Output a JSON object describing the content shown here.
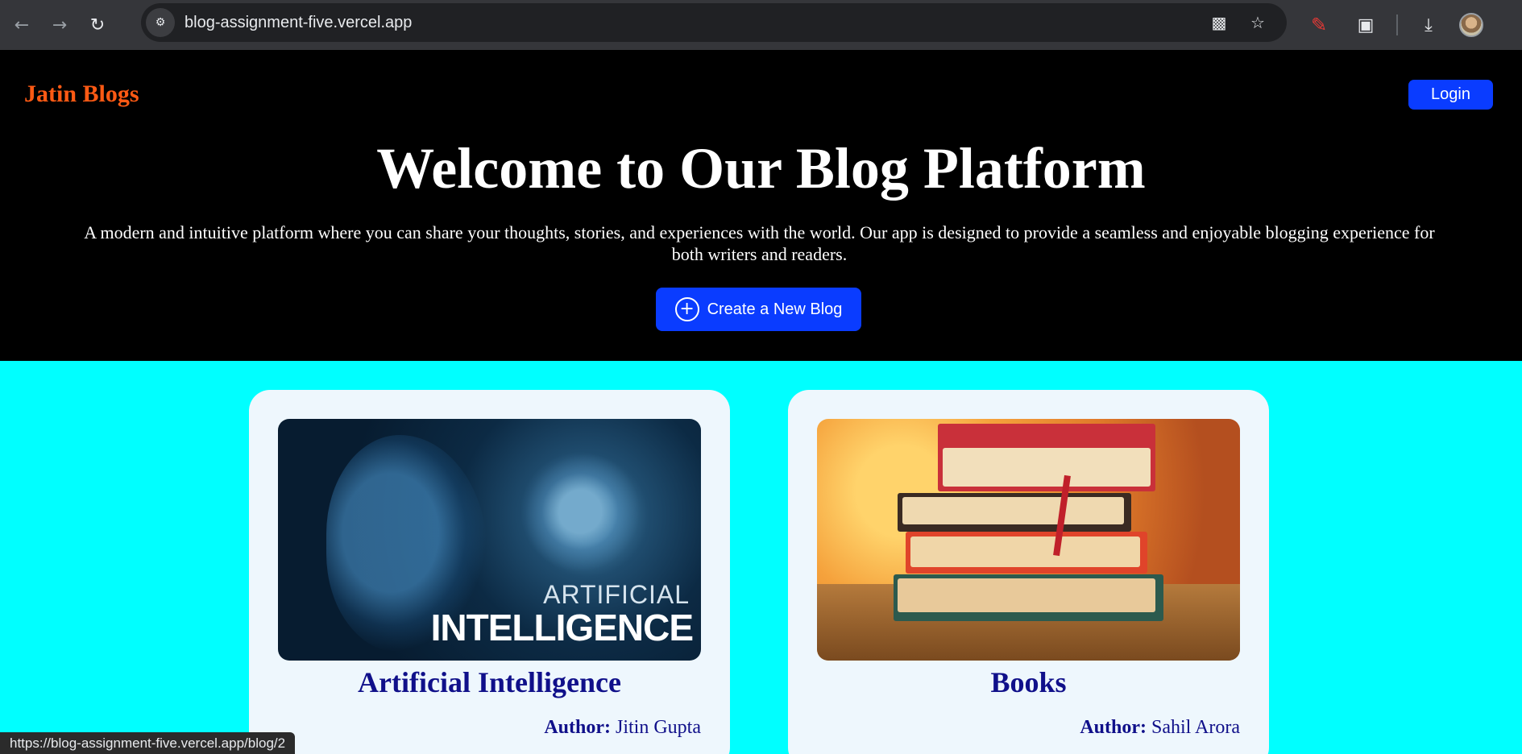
{
  "browser": {
    "url": "blog-assignment-five.vercel.app",
    "status_url": "https://blog-assignment-five.vercel.app/blog/2",
    "icons": {
      "back": "arrow-left",
      "forward": "arrow-right",
      "reload": "reload",
      "site_info": "tune",
      "install": "install-app",
      "bookmark": "star",
      "extension_pen": "pen",
      "extensions": "puzzle",
      "download": "download",
      "profile": "avatar"
    }
  },
  "navbar": {
    "brand": "Jatin Blogs",
    "login_label": "Login",
    "brand_color": "#ff5a14",
    "button_color": "#0a3cff"
  },
  "hero": {
    "title": "Welcome to Our Blog Platform",
    "description": "A modern and intuitive platform where you can share your thoughts, stories, and experiences with the world. Our app is designed to provide a seamless and enjoyable blogging experience for both writers and readers.",
    "create_label": "Create a New Blog",
    "create_icon": "plus-circle"
  },
  "posts": [
    {
      "title": "Artificial Intelligence",
      "author_label": "Author:",
      "author": "Jitin Gupta",
      "image_text_1": "ARTIFICIAL",
      "image_text_2": "INTELLIGENCE"
    },
    {
      "title": "Books",
      "author_label": "Author:",
      "author": "Sahil Arora"
    }
  ],
  "colors": {
    "page_background": "#00ffff",
    "card_background": "#eef7fd",
    "card_title": "#10108a"
  }
}
